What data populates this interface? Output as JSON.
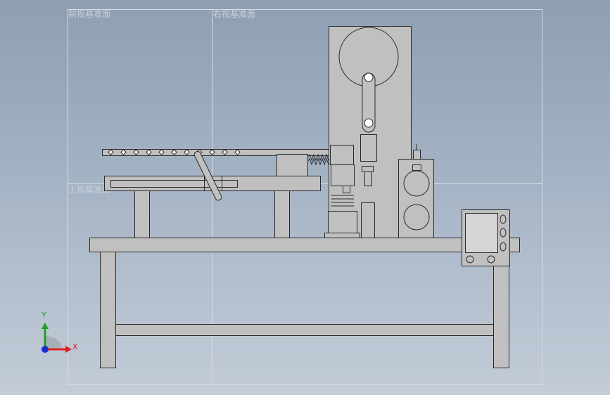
{
  "viewport": {
    "background_top": "#8e9fb3",
    "background_bottom": "#c3ccd8"
  },
  "reference_planes": {
    "front": "前视基准面",
    "right": "右视基准面",
    "top": "上视基准面"
  },
  "triad": {
    "x_label": "X",
    "y_label": "Y",
    "x_color": "#e0201e",
    "y_color": "#20a020",
    "z_color": "#1a2fd0"
  },
  "model": {
    "body_color": "#c0c0c0",
    "edge_color": "#2a2a2a",
    "screen_color": "#d6d6d6"
  }
}
